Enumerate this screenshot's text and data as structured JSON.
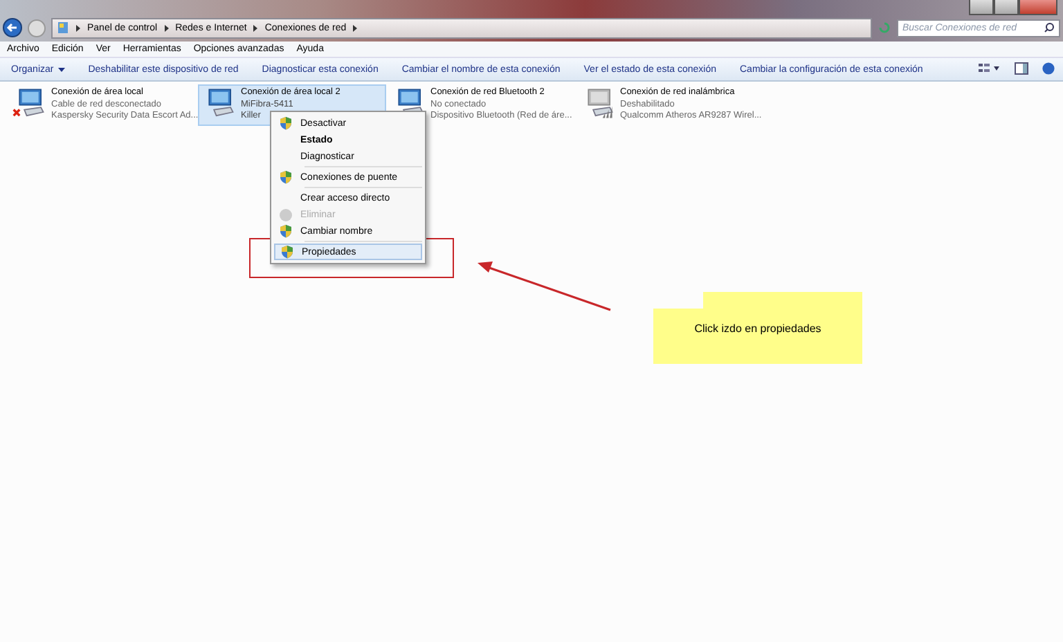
{
  "address": {
    "path": [
      "Panel de control",
      "Redes e Internet",
      "Conexiones de red"
    ],
    "search": {
      "placeholder": "Buscar Conexiones de red"
    }
  },
  "menu_bar": [
    "Archivo",
    "Edición",
    "Ver",
    "Herramientas",
    "Opciones avanzadas",
    "Ayuda"
  ],
  "toolbar": [
    {
      "label": "Organizar",
      "dropdown": true
    },
    {
      "label": "Deshabilitar este dispositivo de red",
      "dropdown": false
    },
    {
      "label": "Diagnosticar esta conexión",
      "dropdown": false
    },
    {
      "label": "Cambiar el nombre de esta conexión",
      "dropdown": false
    },
    {
      "label": "Ver el estado de esta conexión",
      "dropdown": false
    },
    {
      "label": "Cambiar la configuración de esta conexión",
      "dropdown": false
    }
  ],
  "connections": [
    {
      "name": "Conexión de área local",
      "status": "Cable de red desconectado",
      "device": "Kaspersky Security Data Escort Ad...",
      "kind": "wired",
      "error": true,
      "selected": false
    },
    {
      "name": "Conexión de área local 2",
      "status": "MiFibra-5411",
      "device": "Killer",
      "kind": "wired",
      "error": false,
      "selected": true
    },
    {
      "name": "Conexión de red Bluetooth 2",
      "status": "No conectado",
      "device": "Dispositivo Bluetooth (Red de áre...",
      "kind": "wired",
      "selected": false
    },
    {
      "name": "Conexión de red inalámbrica",
      "status": "Deshabilitado",
      "device": "Qualcomm Atheros AR9287 Wirel...",
      "kind": "wireless",
      "error": false,
      "selected": false
    }
  ],
  "context_menu": [
    {
      "kind": "item",
      "label": "Desactivar",
      "shield": true,
      "bold": false,
      "disabled": false,
      "selected": false
    },
    {
      "kind": "item",
      "label": "Estado",
      "shield": false,
      "bold": true,
      "disabled": false,
      "selected": false
    },
    {
      "kind": "item",
      "label": "Diagnosticar",
      "shield": false,
      "bold": false,
      "disabled": false,
      "selected": false
    },
    {
      "kind": "separator"
    },
    {
      "kind": "item",
      "label": "Conexiones de puente",
      "shield": true,
      "bold": false,
      "disabled": false,
      "selected": false
    },
    {
      "kind": "separator"
    },
    {
      "kind": "item",
      "label": "Crear acceso directo",
      "shield": false,
      "bold": false,
      "disabled": false,
      "selected": false
    },
    {
      "kind": "item",
      "label": "Eliminar",
      "shield": true,
      "bold": false,
      "disabled": true,
      "selected": false
    },
    {
      "kind": "item",
      "label": "Cambiar nombre",
      "shield": true,
      "bold": false,
      "disabled": false,
      "selected": false
    },
    {
      "kind": "separator"
    },
    {
      "kind": "item",
      "label": "Propiedades",
      "shield": true,
      "bold": false,
      "disabled": false,
      "selected": true
    }
  ],
  "annotation": {
    "note": "Click izdo en propiedades"
  }
}
